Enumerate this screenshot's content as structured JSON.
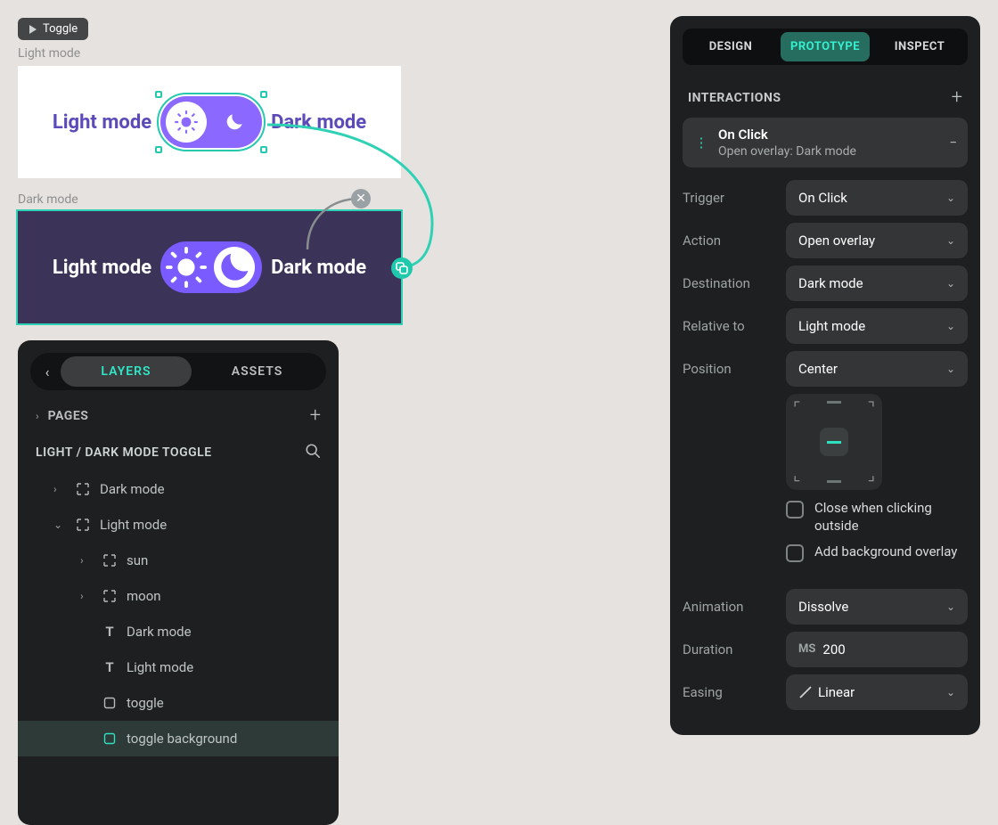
{
  "flow_button": "Toggle",
  "frame_labels": {
    "light": "Light mode",
    "dark": "Dark mode"
  },
  "canvas_text": {
    "light_label": "Light mode",
    "dark_label": "Dark mode"
  },
  "layers_panel": {
    "tabs": {
      "layers": "LAYERS",
      "assets": "ASSETS"
    },
    "pages_label": "PAGES",
    "page_title": "LIGHT / DARK MODE TOGGLE",
    "tree": {
      "dark_mode": "Dark mode",
      "light_mode": "Light mode",
      "sun": "sun",
      "moon": "moon",
      "dark_text": "Dark mode",
      "light_text": "Light mode",
      "toggle": "toggle",
      "toggle_bg": "toggle background"
    }
  },
  "proto_panel": {
    "tabs": {
      "design": "DESIGN",
      "prototype": "PROTOTYPE",
      "inspect": "INSPECT"
    },
    "interactions_label": "INTERACTIONS",
    "interaction": {
      "title": "On Click",
      "subtitle": "Open overlay: Dark mode"
    },
    "labels": {
      "trigger": "Trigger",
      "action": "Action",
      "destination": "Destination",
      "relative_to": "Relative to",
      "position": "Position",
      "animation": "Animation",
      "duration": "Duration",
      "easing": "Easing"
    },
    "values": {
      "trigger": "On Click",
      "action": "Open overlay",
      "destination": "Dark mode",
      "relative_to": "Light mode",
      "position": "Center",
      "animation": "Dissolve",
      "duration_unit": "MS",
      "duration_value": "200",
      "easing": "Linear"
    },
    "checkboxes": {
      "close_outside": "Close when clicking outside",
      "bg_overlay": "Add background overlay"
    }
  }
}
